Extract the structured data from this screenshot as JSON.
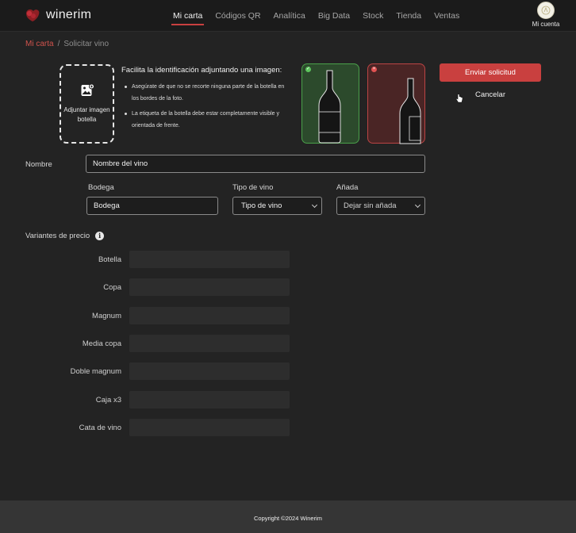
{
  "brand": {
    "name": "winerim",
    "accent": "#c9403f"
  },
  "nav": {
    "items": [
      {
        "label": "Mi carta",
        "active": true
      },
      {
        "label": "Códigos QR",
        "active": false
      },
      {
        "label": "Analítica",
        "active": false
      },
      {
        "label": "Big Data",
        "active": false
      },
      {
        "label": "Stock",
        "active": false
      },
      {
        "label": "Tienda",
        "active": false
      },
      {
        "label": "Ventas",
        "active": false
      }
    ],
    "account_label": "Mi cuenta"
  },
  "breadcrumb": {
    "parent": "Mi carta",
    "separator": "/",
    "current": "Solicitar vino"
  },
  "upload": {
    "label": "Adjuntar imagen botella",
    "icon": "image-add-icon",
    "tips_title": "Facilita la identificación adjuntando una imagen:",
    "tips": [
      "Asegúrate de que no se recorte ninguna parte de la botella en los bordes de la foto.",
      "La etiqueta de la botella debe estar completamente visible y orientada de frente."
    ],
    "good_color": "#4aa14a",
    "bad_color": "#b44444"
  },
  "actions": {
    "submit": "Enviar solicitud",
    "cancel": "Cancelar"
  },
  "form": {
    "name_label": "Nombre",
    "name_value": "Nombre del vino",
    "bodega_label": "Bodega",
    "bodega_value": "Bodega",
    "tipo_label": "Tipo de vino",
    "tipo_value": "Tipo de vino",
    "anada_label": "Añada",
    "anada_value": "Dejar sin añada"
  },
  "prices": {
    "title": "Variantes de precio",
    "rows": [
      "Botella",
      "Copa",
      "Magnum",
      "Media copa",
      "Doble magnum",
      "Caja x3",
      "Cata de vino"
    ]
  },
  "footer": {
    "copyright": "Copyright ©2024 Winerim"
  }
}
